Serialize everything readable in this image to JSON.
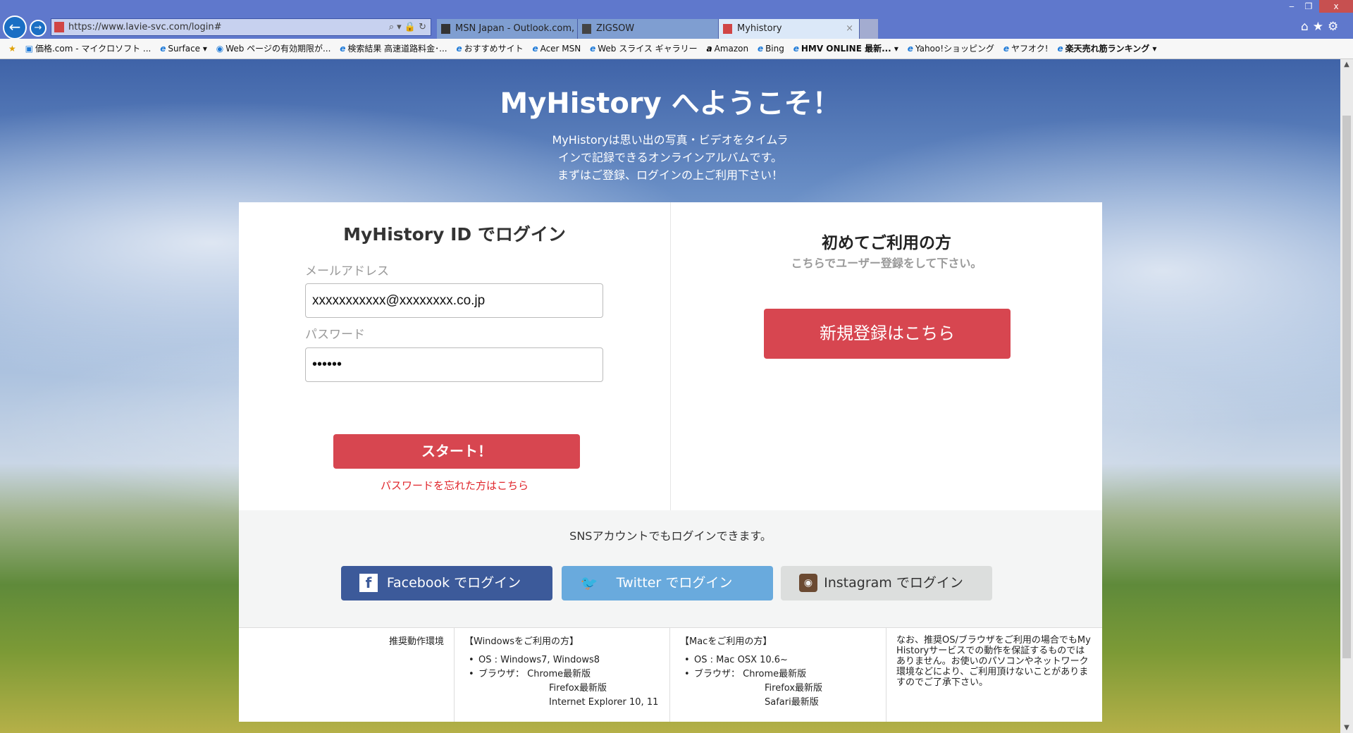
{
  "browser": {
    "url": "https://www.lavie-svc.com/login#",
    "tabs": [
      {
        "label": "MSN Japan - Outlook.com, ..."
      },
      {
        "label": "ZIGSOW"
      },
      {
        "label": "Myhistory",
        "close": "×"
      }
    ],
    "window_controls": {
      "minimize": "‒",
      "restore": "❐",
      "close": "x"
    },
    "bookmarks": [
      "価格.com - マイクロソフト ...",
      "Surface ▾",
      "Web ページの有効期限が...",
      "検索結果  高速道路料金･...",
      "おすすめサイト",
      "Acer  MSN",
      "Web スライス ギャラリー",
      "Amazon",
      "Bing",
      "HMV ONLINE 最新... ▾",
      "Yahoo!ショッピング",
      "ヤフオク!",
      "楽天売れ筋ランキング ▾"
    ]
  },
  "hero": {
    "title": "MyHistory へようこそ！",
    "lines": [
      "MyHistoryは思い出の写真・ビデオをタイムラ",
      "インで記録できるオンラインアルバムです。",
      "まずはご登録、ログインの上ご利用下さい！"
    ]
  },
  "login": {
    "title": "MyHistory ID でログイン",
    "email_label": "メールアドレス",
    "email_value": "xxxxxxxxxxx@xxxxxxxx.co.jp",
    "password_label": "パスワード",
    "password_value": "••••••",
    "start": "スタート！",
    "forgot": "パスワードを忘れた方はこちら"
  },
  "signup": {
    "title": "初めてご利用の方",
    "subtitle": "こちらでユーザー登録をして下さい。",
    "button": "新規登録はこちら"
  },
  "sns": {
    "text": "SNSアカウントでもログインできます。",
    "facebook": "Facebook でログイン",
    "twitter": "Twitter でログイン",
    "instagram": "Instagram でログイン"
  },
  "footer": {
    "heading": "推奨動作環境",
    "windows": {
      "title": "【Windowsをご利用の方】",
      "os": "OS : Windows7, Windows8",
      "browser": "ブラウザ：  Chrome最新版",
      "b2": "Firefox最新版",
      "b3": "Internet Explorer 10, 11"
    },
    "mac": {
      "title": "【Macをご利用の方】",
      "os": "OS : Mac OSX 10.6~",
      "browser": "ブラウザ：  Chrome最新版",
      "b2": "Firefox最新版",
      "b3": "Safari最新版"
    },
    "note": "なお、推奨OS/ブラウザをご利用の場合でもMy Historyサービスでの動作を保証するものではありません。お使いのパソコンやネットワーク環境などにより、ご利用頂けないことがありますのでご了承下さい。"
  },
  "colors": {
    "accent": "#d74650",
    "facebook": "#3c5a9a",
    "twitter": "#69aadd",
    "instagram": "#dcdedd"
  }
}
